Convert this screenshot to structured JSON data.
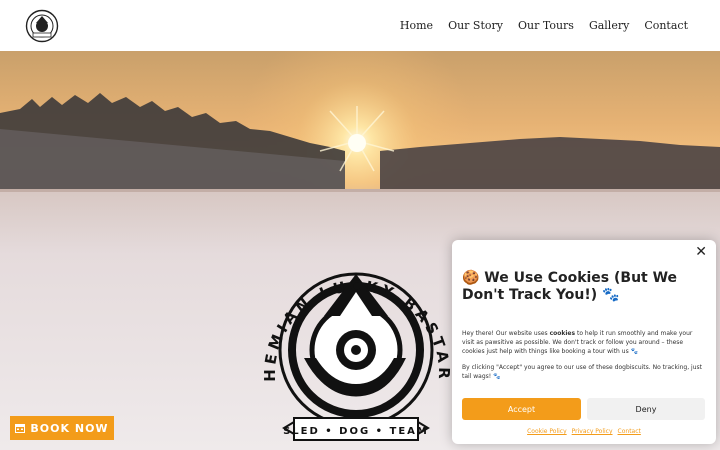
{
  "header": {
    "logo_icon": "bohemian-lucky-bastards-logo",
    "nav": [
      {
        "label": "Home"
      },
      {
        "label": "Our Story"
      },
      {
        "label": "Our Tours"
      },
      {
        "label": "Gallery"
      },
      {
        "label": "Contact"
      }
    ]
  },
  "hero": {
    "badge": {
      "arc_text": "BOHEMIAN LUCKY BASTARDS",
      "banner_text": "SLED • DOG • TEAM"
    }
  },
  "book_now": {
    "icon": "calendar-icon",
    "label": "BOOK NOW",
    "color": "#f39c1a"
  },
  "cookie_dialog": {
    "close_label": "✕",
    "title": "🍪 We Use Cookies (But We Don't Track You!) 🐾",
    "body_pre": "Hey there! Our website uses ",
    "body_bold": "cookies",
    "body_post": " to help it run smoothly and make your visit as pawsitive as possible. We don't track or follow you around – these cookies just help with things like booking a tour with us 🐾",
    "body2": "By clicking \"Accept\" you agree to our use of these dogbiscuits. No tracking, just tail wags! 🐾",
    "accept_label": "Accept",
    "deny_label": "Deny",
    "links": [
      {
        "label": "Cookie Policy"
      },
      {
        "label": "Privacy Policy"
      },
      {
        "label": "Contact"
      }
    ]
  }
}
